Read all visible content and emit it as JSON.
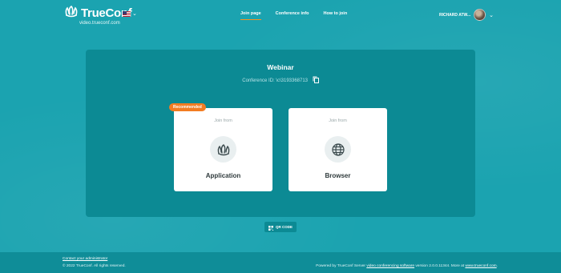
{
  "header": {
    "logo_text": "TrueConf",
    "domain": "video.trueconf.com",
    "nav": [
      {
        "label": "Join page",
        "active": true
      },
      {
        "label": "Conference info",
        "active": false
      },
      {
        "label": "How to join",
        "active": false
      }
    ],
    "user_name": "RICHARD ATW..."
  },
  "panel": {
    "title": "Webinar",
    "conference_id": "Conference ID: \\c\\3193368713"
  },
  "cards": {
    "app": {
      "join_from": "Join from",
      "label": "Application",
      "badge": "Recommended"
    },
    "browser": {
      "join_from": "Join from",
      "label": "Browser"
    }
  },
  "qr": {
    "label": "QR CODE"
  },
  "footer": {
    "contact": "Contact your administrator",
    "copyright": "© 2022 TrueConf. All rights reserved.",
    "powered_prefix": "Powered by TrueConf Server ",
    "powered_link": "video conferencing software",
    "powered_mid": " version 2.0.0.11344. More at ",
    "powered_site": "www.trueconf.com",
    "powered_end": "."
  },
  "colors": {
    "background": "#1ba3b0",
    "panel": "#0c8a94",
    "accent": "#f37c22"
  }
}
